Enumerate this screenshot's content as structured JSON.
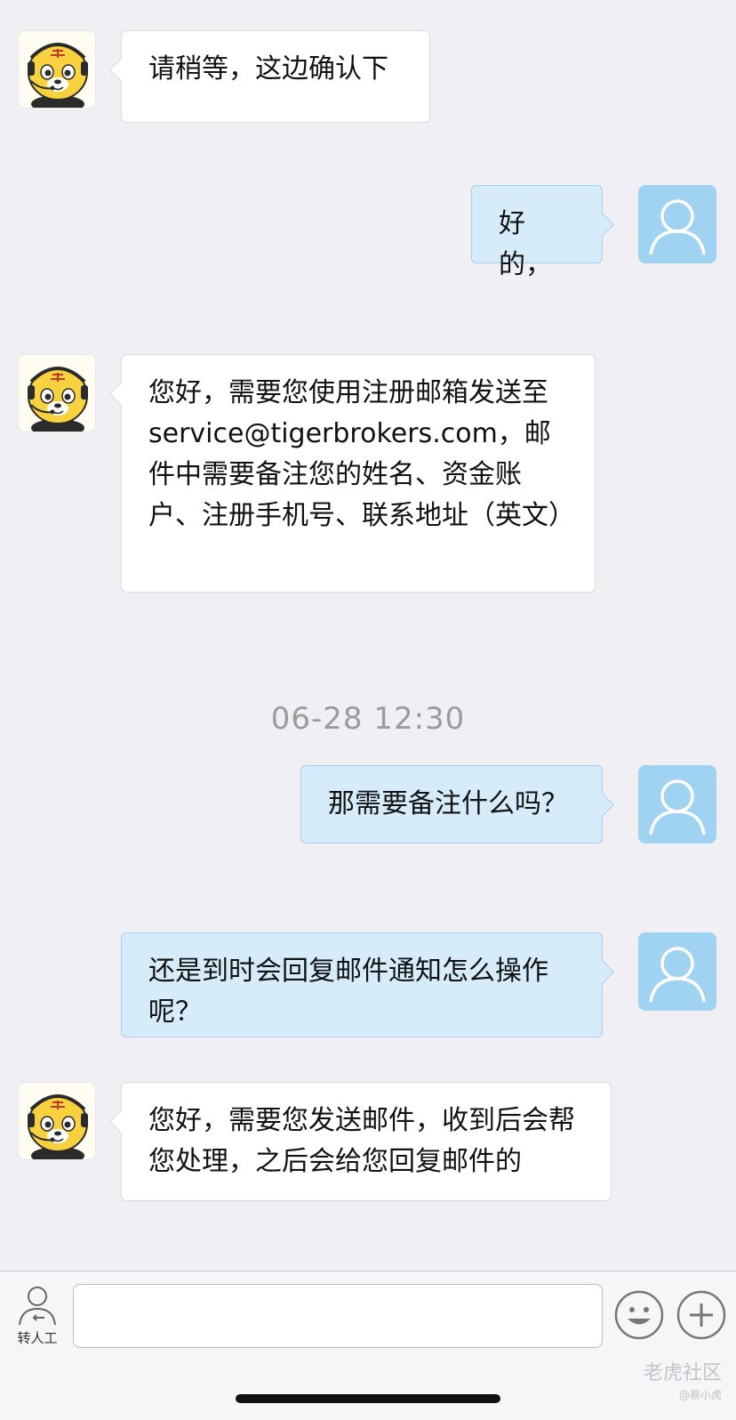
{
  "messages": [
    {
      "text": "请稍等，这边确认下"
    },
    {
      "text": "好的，"
    },
    {
      "text": "您好，需要您使用注册邮箱发送至 service@tigerbrokers.com，邮件中需要备注您的姓名、资金账户、注册手机号、联系地址（英文）"
    },
    {
      "text": "那需要备注什么吗？"
    },
    {
      "text": "还是到时会回复邮件通知怎么操作呢？"
    },
    {
      "text": "您好，需要您发送邮件，收到后会帮您处理，之后会给您回复邮件的"
    }
  ],
  "timestamp": "06-28 12:30",
  "bottom_bar": {
    "transfer_label": "转人工",
    "input_value": ""
  },
  "watermark": {
    "brand": "老虎社区",
    "user": "@蔡小虎"
  },
  "colors": {
    "background": "#efeff4",
    "user_bubble": "#d6ecfb",
    "agent_bubble": "#ffffff",
    "user_avatar": "#9fd3f1"
  },
  "icons": {
    "agent_avatar": "tiger-agent-avatar-icon",
    "user_avatar": "user-avatar-icon",
    "transfer": "transfer-to-human-icon",
    "emoji": "emoji-icon",
    "plus": "plus-icon"
  }
}
